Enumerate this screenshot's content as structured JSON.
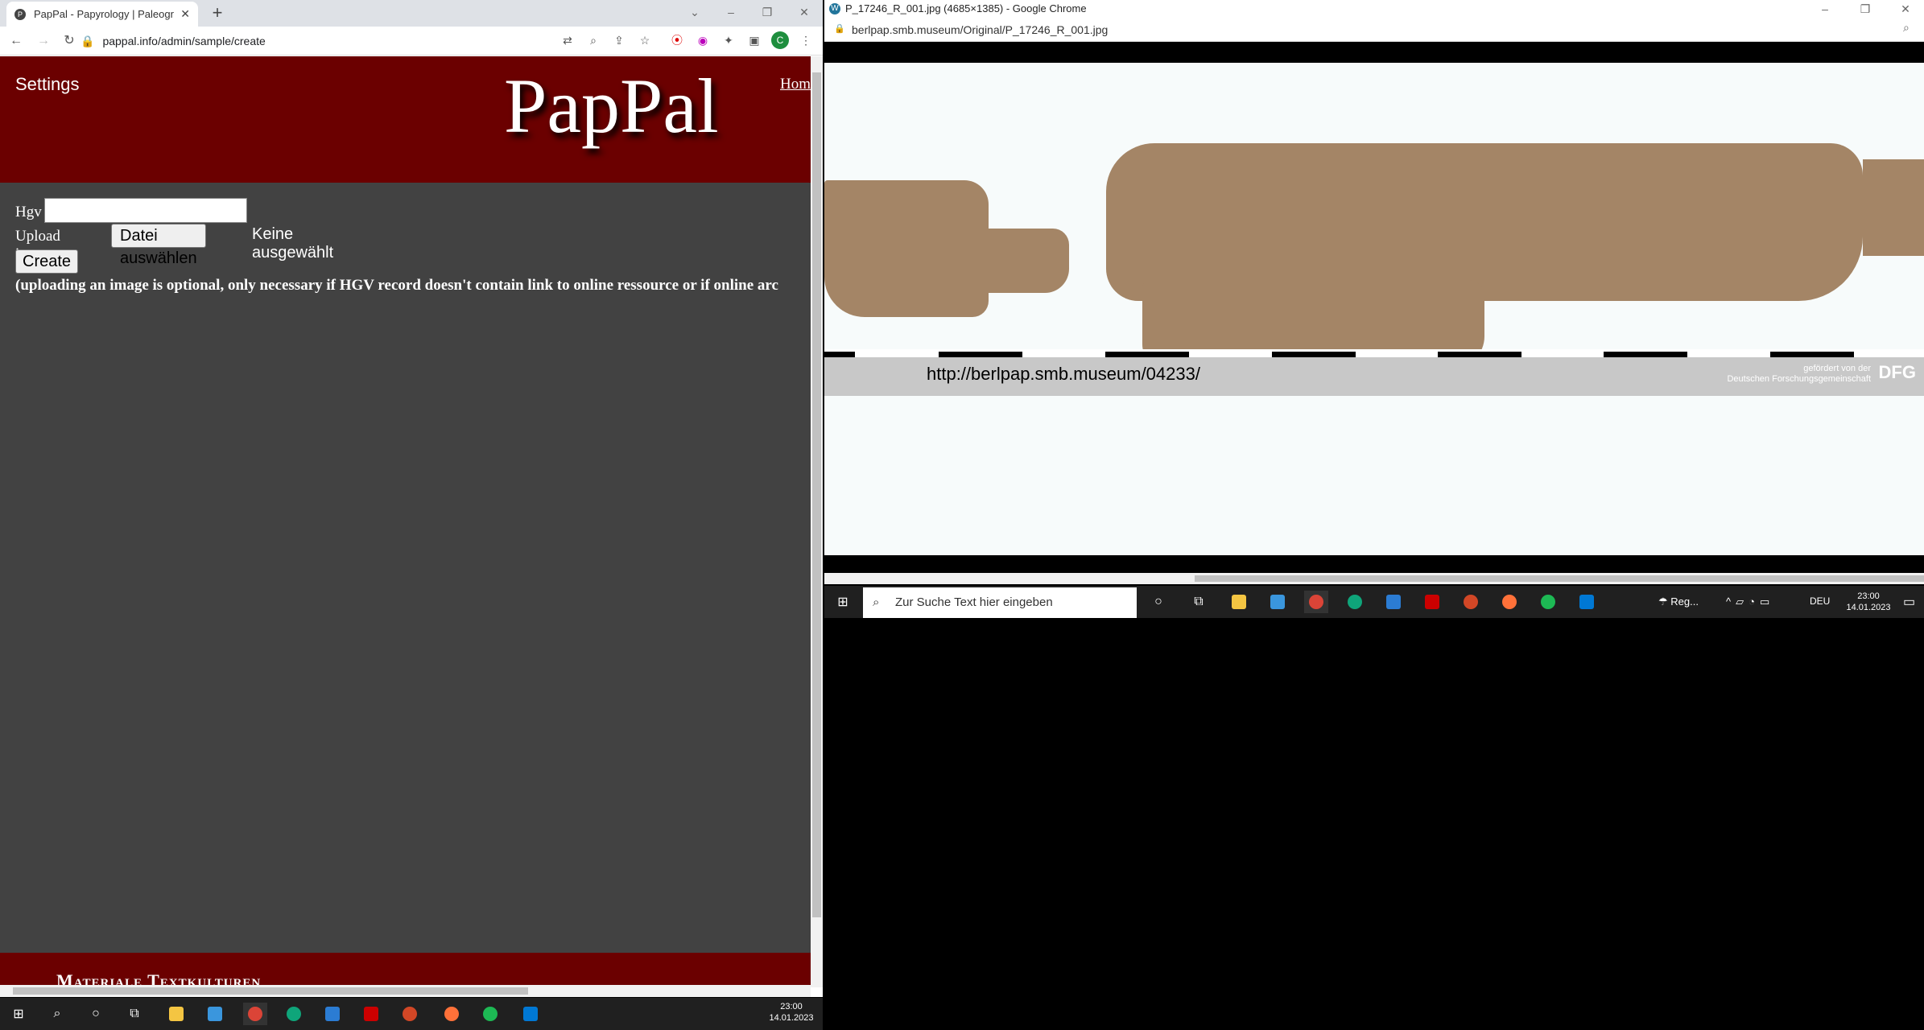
{
  "left_window": {
    "tab_title": "PapPal - Papyrology | Paleograph",
    "tab_favicon": "P",
    "address": "pappal.info/admin/sample/create",
    "header": {
      "settings": "Settings",
      "logo": "PapPal",
      "home_link": "Hom"
    },
    "form": {
      "hgv_label": "Hgv",
      "hgv_value": "",
      "upload_label": "Upload image",
      "file_button": "Datei auswählen",
      "file_status": "Keine ausgewählt",
      "create_button": "Create",
      "note": "(uploading an image is optional, only necessary if HGV record doesn't contain link to online ressource or if online arc"
    },
    "footer_text": "Materiale Textkulturen"
  },
  "right_window": {
    "title": "P_17246_R_001.jpg (4685×1385) - Google Chrome",
    "address": "berlpap.smb.museum/Original/P_17246_R_001.jpg",
    "image_url_text": "http://berlpap.smb.museum/04233/",
    "dfg_line1": "gefördert von der",
    "dfg_line2": "Deutschen Forschungsgemeinschaft",
    "dfg_logo": "DFG"
  },
  "right_taskbar": {
    "search_placeholder": "Zur Suche Text hier eingeben",
    "weather": "Reg...",
    "language": "DEU",
    "time": "23:00",
    "date": "14.01.2023"
  },
  "bottom_taskbar": {
    "time": "23:00",
    "date": "14.01.2023"
  },
  "colors": {
    "header_red": "#6b0000",
    "page_gray": "#424242",
    "papyrus": "#a48566"
  }
}
